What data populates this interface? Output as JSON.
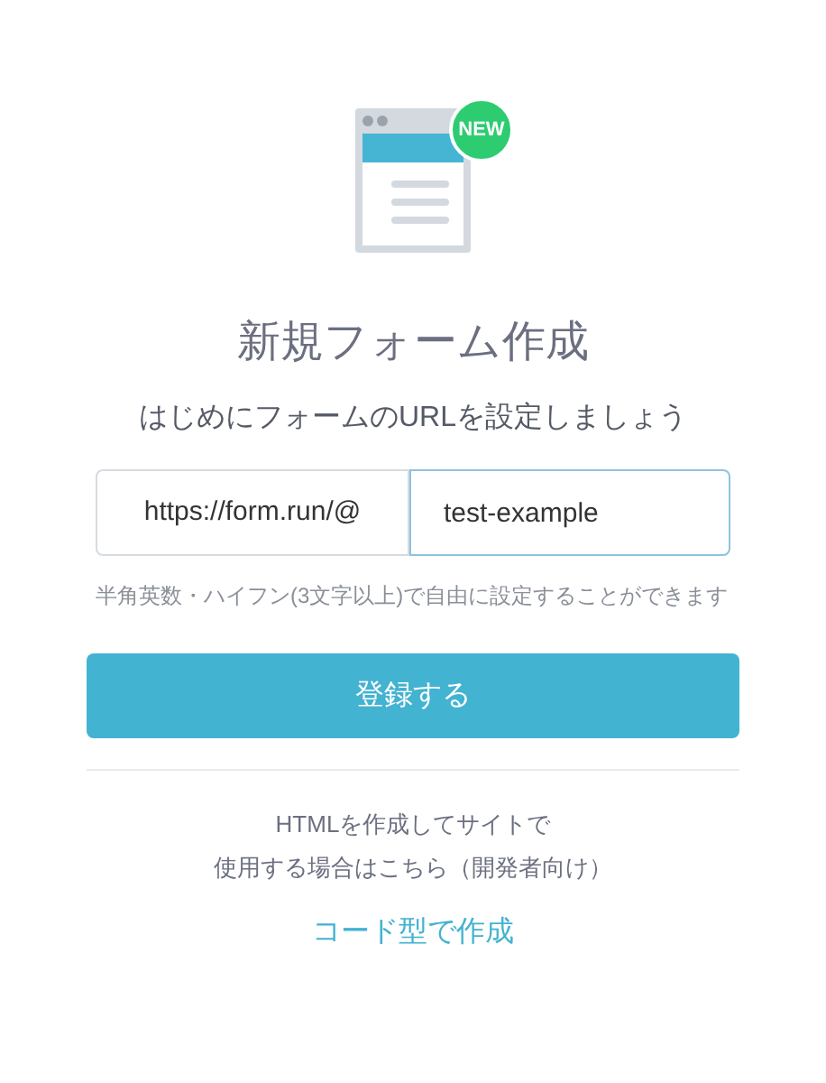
{
  "icon_badge": "NEW",
  "title": "新規フォーム作成",
  "subtitle": "はじめにフォームのURLを設定しましょう",
  "url_field": {
    "prefix": "https://form.run/@",
    "value": "test-example"
  },
  "hint": "半角英数・ハイフン(3文字以上)で自由に設定することができます",
  "submit_button": "登録する",
  "developer_note": [
    "HTMLを作成してサイトで",
    "使用する場合はこちら（開発者向け）"
  ],
  "code_link": "コード型で作成"
}
